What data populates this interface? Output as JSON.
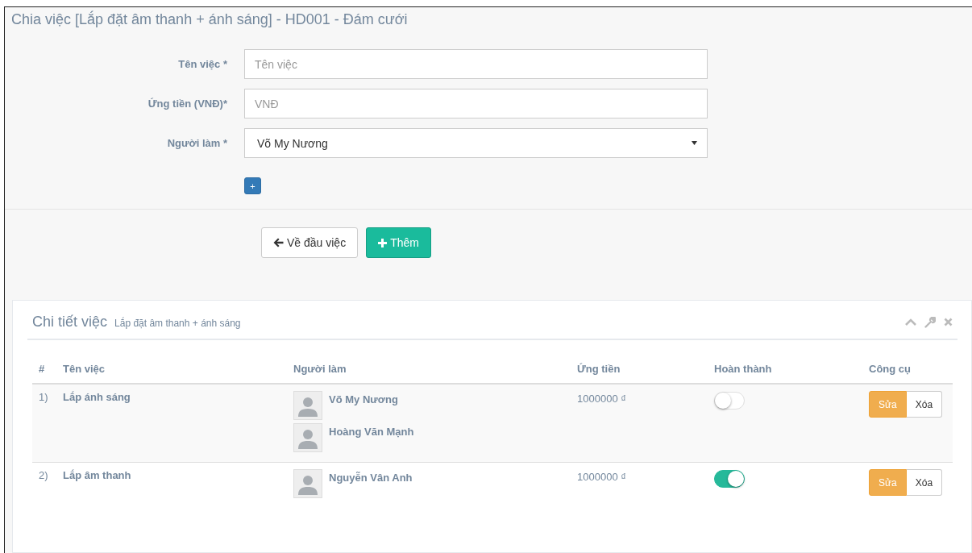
{
  "title": "Chia việc [Lắp đặt âm thanh + ánh sáng] - HD001 - Đám cưới",
  "form": {
    "fields": [
      {
        "kind": "input",
        "label": "Tên việc *",
        "placeholder": "Tên việc"
      },
      {
        "kind": "input",
        "label": "Ứng tiền (VNĐ)*",
        "placeholder": "VNĐ"
      },
      {
        "kind": "select",
        "label": "Người làm *",
        "value": "Võ My Nương"
      }
    ],
    "add_person": "+"
  },
  "buttons": {
    "back": "Về đầu việc",
    "add": "Thêm"
  },
  "panel": {
    "title": "Chi tiết việc",
    "subtitle": "Lắp đặt âm thanh + ánh sáng",
    "table": {
      "columns": [
        "#",
        "Tên việc",
        "Người làm",
        "Ứng tiền",
        "Hoàn thành",
        "Công cụ"
      ],
      "rows": [
        {
          "number": "1)",
          "name": "Lắp ánh sáng",
          "workers": [
            "Võ My Nương",
            "Hoàng Văn Mạnh"
          ],
          "amount": "1000000 ₫",
          "done": false,
          "edit": "Sửa",
          "delete": "Xóa"
        },
        {
          "number": "2)",
          "name": "Lắp âm thanh",
          "workers": [
            "Nguyễn Vân Anh"
          ],
          "amount": "1000000 ₫",
          "done": true,
          "edit": "Sửa",
          "delete": "Xóa"
        }
      ]
    }
  }
}
